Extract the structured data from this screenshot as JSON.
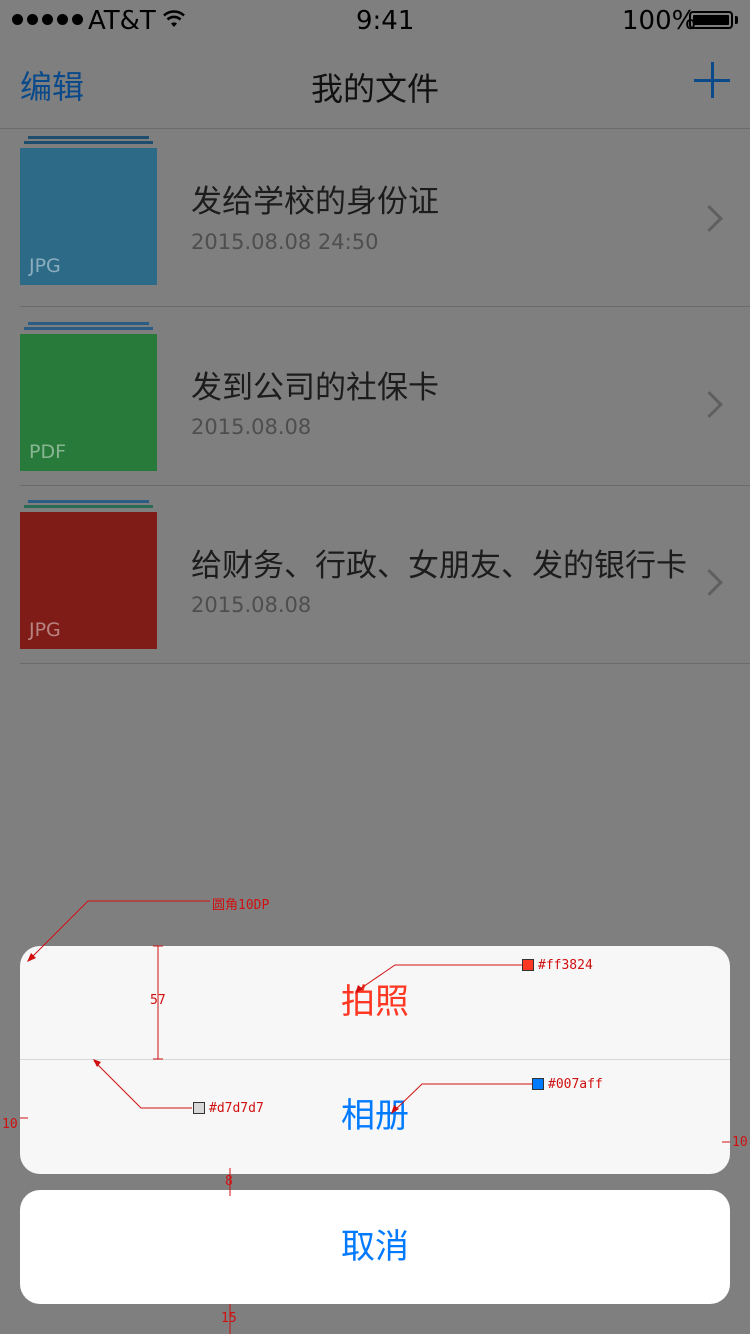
{
  "status_bar": {
    "carrier": "AT&T",
    "time": "9:41",
    "battery": "100%"
  },
  "nav": {
    "edit_label": "编辑",
    "title": "我的文件",
    "add_icon": "plus-icon"
  },
  "files": [
    {
      "name": "发给学校的身份证",
      "date": "2015.08.08  24:50",
      "type": "JPG",
      "color": "#2c6a87",
      "stack_color": "#1e4e6d"
    },
    {
      "name": "发到公司的社保卡",
      "date": "2015.08.08",
      "type": "PDF",
      "color": "#287a3a",
      "stack_color": "#2b5c84"
    },
    {
      "name": "给财务、行政、女朋友、发的银行卡",
      "date": "2015.08.08",
      "type": "JPG",
      "color": "#7f1c18",
      "stack_color": "#2b5c84"
    }
  ],
  "action_sheet": {
    "take_photo": "拍照",
    "album": "相册",
    "cancel": "取消",
    "take_photo_color": "#ff3824",
    "album_color": "#007aff",
    "separator_color": "#d7d7d7"
  },
  "annotations": {
    "corner_radius": "圆角10DP",
    "row_height": "57",
    "take_photo_color": "#ff3824",
    "album_color": "#007aff",
    "separator_color": "#d7d7d7",
    "side_margin_left": "10",
    "side_margin_right": "10",
    "gap": "8",
    "bottom_margin": "15"
  }
}
